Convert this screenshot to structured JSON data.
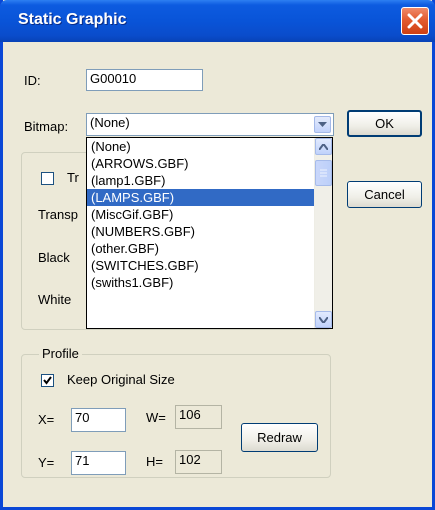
{
  "window": {
    "title": "Static Graphic"
  },
  "fields": {
    "id_label": "ID:",
    "id_value": "G00010",
    "bitmap_label": "Bitmap:",
    "bitmap_value": "(None)"
  },
  "buttons": {
    "ok": "OK",
    "cancel": "Cancel",
    "redraw": "Redraw"
  },
  "transparency": {
    "checkbox_label_partial": "Tr",
    "transp_label_partial": "Transp",
    "black_label": "Black",
    "white_label": "White"
  },
  "bitmap_dropdown": {
    "items": [
      {
        "label": "(None)",
        "selected": false
      },
      {
        "label": "(ARROWS.GBF)",
        "selected": false
      },
      {
        "label": "(lamp1.GBF)",
        "selected": false
      },
      {
        "label": "(LAMPS.GBF)",
        "selected": true
      },
      {
        "label": "(MiscGif.GBF)",
        "selected": false
      },
      {
        "label": "(NUMBERS.GBF)",
        "selected": false
      },
      {
        "label": "(other.GBF)",
        "selected": false
      },
      {
        "label": "(SWITCHES.GBF)",
        "selected": false
      },
      {
        "label": "(swiths1.GBF)",
        "selected": false
      }
    ]
  },
  "profile": {
    "title": "Profile",
    "keep_original_size_label": "Keep Original Size",
    "keep_original_size_checked": true,
    "x_label": "X=",
    "x_value": "70",
    "y_label": "Y=",
    "y_value": "71",
    "w_label": "W=",
    "w_value": "106",
    "h_label": "H=",
    "h_value": "102"
  },
  "colors": {
    "selection": "#316ac5",
    "titlebar": "#0a4ccb",
    "close": "#e35b2f",
    "dialog_bg": "#ece9d8"
  }
}
